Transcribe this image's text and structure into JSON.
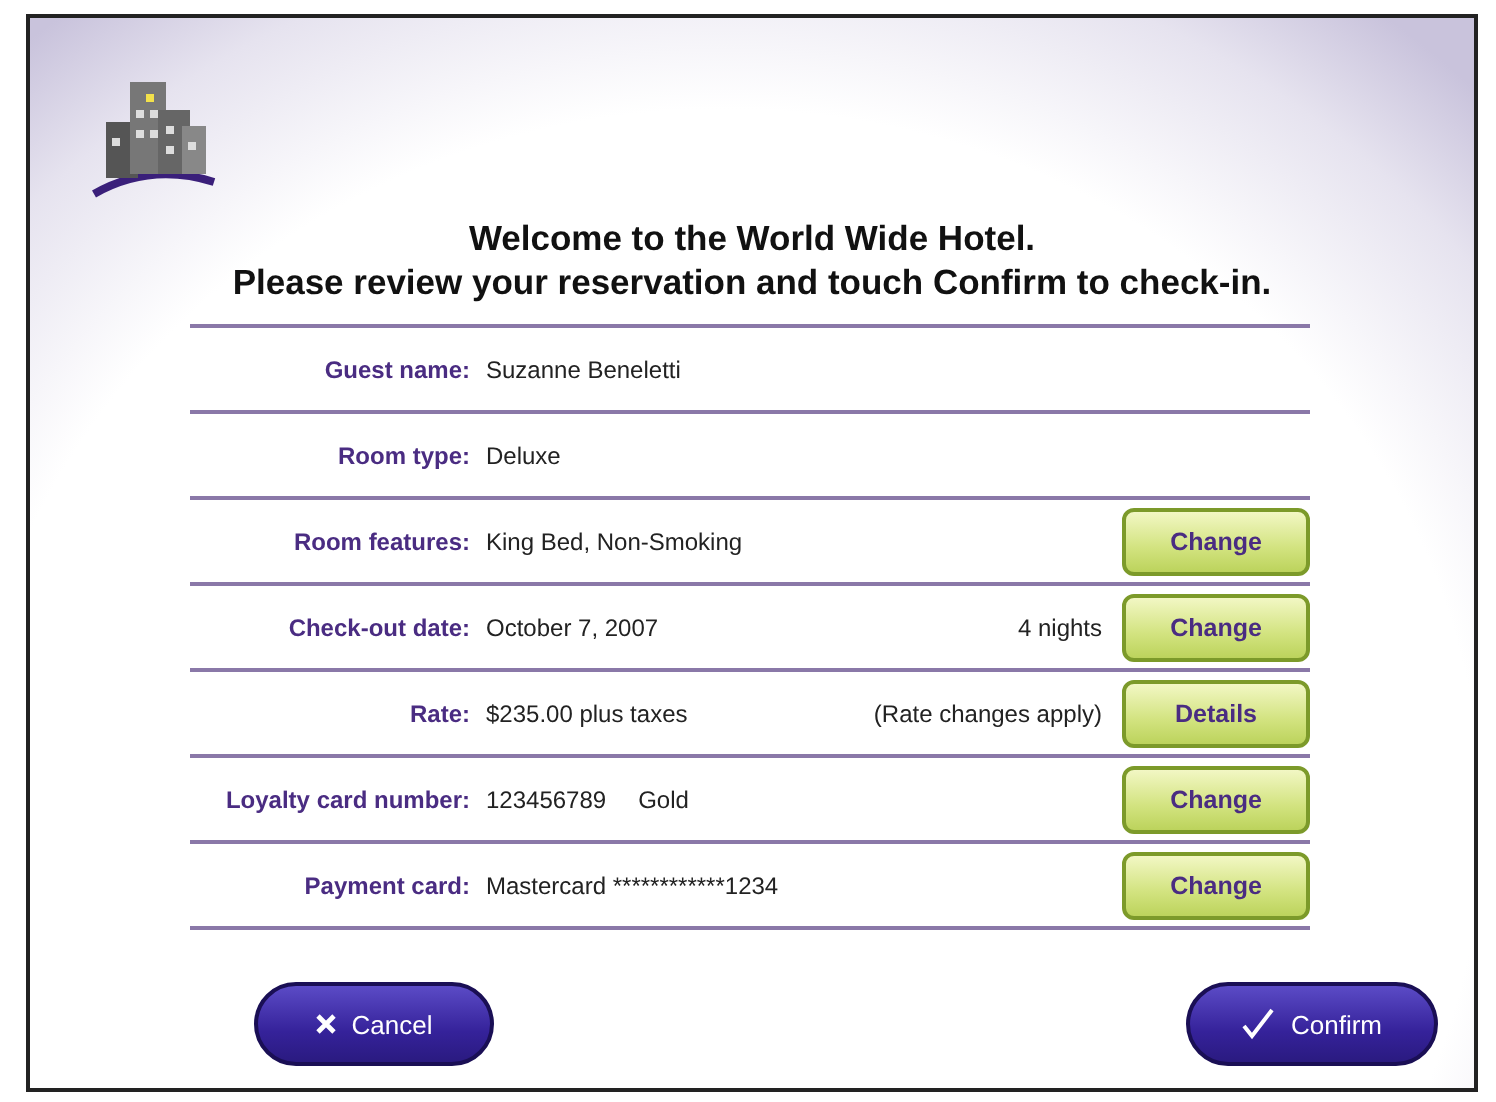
{
  "heading": [
    "Welcome to the World Wide Hotel.",
    "Please review your reservation and touch Confirm to check-in."
  ],
  "rows": [
    {
      "label": "Guest name:",
      "value": "Suzanne Beneletti"
    },
    {
      "label": "Room type:",
      "value": "Deluxe"
    },
    {
      "label": "Room features:",
      "value": "King Bed, Non-Smoking",
      "button": "Change"
    },
    {
      "label": "Check-out date:",
      "value": "October 7, 2007",
      "note": "4 nights",
      "button": "Change"
    },
    {
      "label": "Rate:",
      "value": "$235.00 plus taxes",
      "note": "(Rate changes apply)",
      "button": "Details"
    },
    {
      "label": "Loyalty card number:",
      "value": "123456789",
      "value2": "Gold",
      "button": "Change"
    },
    {
      "label": "Payment card:",
      "value": "Mastercard ************1234",
      "button": "Change"
    }
  ],
  "actions": {
    "cancel": "Cancel",
    "confirm": "Confirm"
  }
}
